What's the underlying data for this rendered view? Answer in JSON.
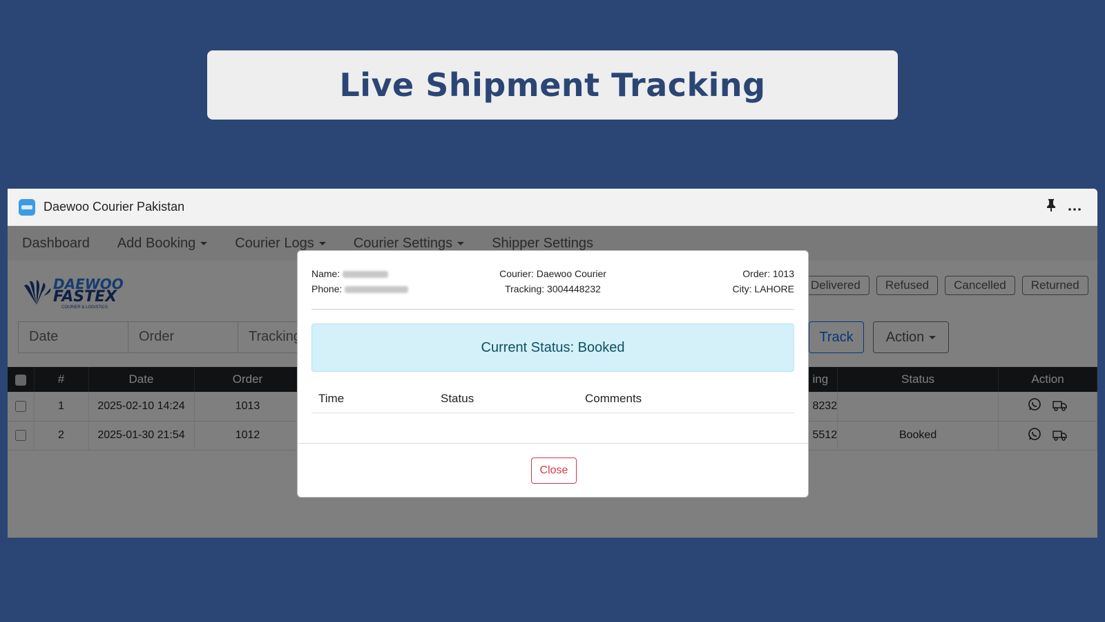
{
  "hero": {
    "title": "Live Shipment Tracking"
  },
  "window": {
    "title": "Daewoo Courier Pakistan",
    "pin_icon": "pin-icon",
    "more_icon": "more-icon"
  },
  "nav": {
    "dashboard": "Dashboard",
    "add_booking": "Add Booking",
    "courier_logs": "Courier Logs",
    "courier_settings": "Courier Settings",
    "shipper_settings": "Shipper Settings"
  },
  "logo": {
    "line1": "DAEWOO",
    "line2": "FASTEX",
    "line3": "COURIER & LOGISTICS"
  },
  "status_filters": [
    "Delivered",
    "Refused",
    "Cancelled",
    "Returned"
  ],
  "filters": {
    "date": "Date",
    "order": "Order",
    "tracking": "Tracking"
  },
  "buttons": {
    "track": "Track",
    "action": "Action"
  },
  "table": {
    "headers": {
      "num": "#",
      "date": "Date",
      "order": "Order",
      "tracking": "ing",
      "status": "Status",
      "action": "Action"
    },
    "rows": [
      {
        "num": "1",
        "date": "2025-02-10 14:24",
        "order": "1013",
        "tracking": "8232",
        "status": ""
      },
      {
        "num": "2",
        "date": "2025-01-30 21:54",
        "order": "1012",
        "tracking": "5512",
        "status": "Booked"
      }
    ]
  },
  "modal": {
    "name_label": "Name:",
    "phone_label": "Phone:",
    "courier": "Courier: Daewoo Courier",
    "tracking": "Tracking: 3004448232",
    "order": "Order: 1013",
    "city": "City: LAHORE",
    "current_status": "Current Status: Booked",
    "history_headers": {
      "time": "Time",
      "status": "Status",
      "comments": "Comments"
    },
    "close": "Close"
  },
  "colors": {
    "page_bg": "#2b4675",
    "accent": "#0d6efd",
    "danger": "#dc3545",
    "success": "#198754",
    "info_bg": "#d4f0f8"
  }
}
